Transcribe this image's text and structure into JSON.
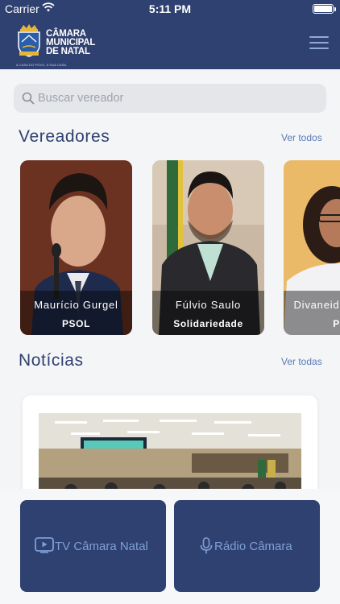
{
  "status_bar": {
    "carrier": "Carrier",
    "time": "5:11 PM"
  },
  "header": {
    "logo_lines": [
      "CÂMARA",
      "MUNICIPAL",
      "DE NATAL"
    ],
    "motto": "A CASA DO POVO, A SUA CASA.",
    "menu_icon": "hamburger-menu-icon"
  },
  "search": {
    "placeholder": "Buscar vereador",
    "value": ""
  },
  "vereadores": {
    "title": "Vereadores",
    "link": "Ver todos",
    "items": [
      {
        "name": "Maurício Gurgel",
        "party": "PSOL"
      },
      {
        "name": "Fúlvio Saulo",
        "party": "Solidariedade"
      },
      {
        "name": "Divaneide Basílio",
        "party": "PT"
      }
    ]
  },
  "noticias": {
    "title": "Notícias",
    "link": "Ver todas"
  },
  "bottom": {
    "tv_label": "TV Câmara Natal",
    "tv_icon": "play-video-icon",
    "radio_label": "Rádio Câmara",
    "radio_icon": "microphone-icon"
  },
  "colors": {
    "primary": "#2f4170",
    "link": "#5b7bb5",
    "button_text": "#7f9fd6",
    "background": "#f4f5f7"
  }
}
